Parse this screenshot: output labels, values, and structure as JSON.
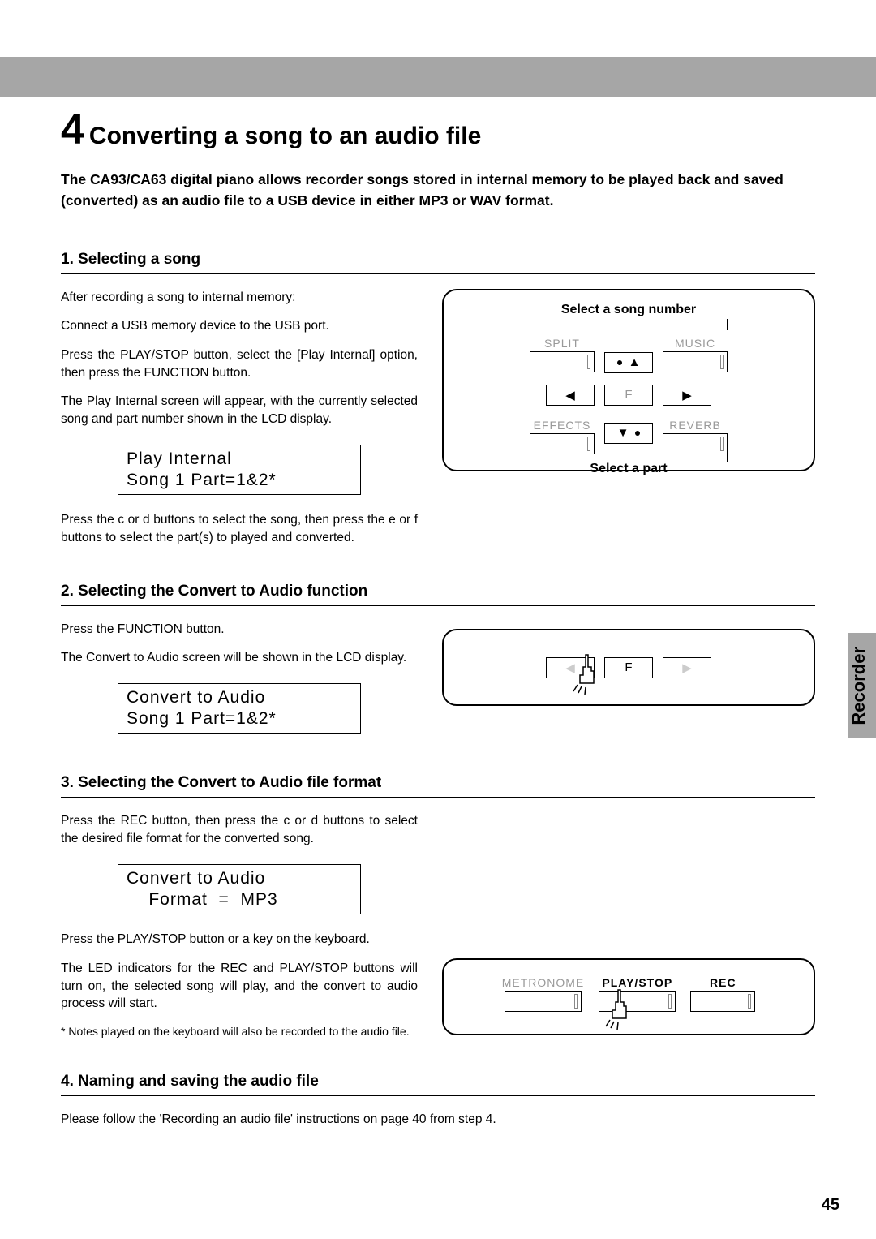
{
  "page_number": "45",
  "side_tab": "Recorder",
  "title_num": "4",
  "title_text": "Converting a song to an audio file",
  "intro": "The CA93/CA63 digital piano allows recorder songs stored in internal memory to be played back and saved (converted) as an audio file to a USB device in either MP3 or WAV format.",
  "s1": {
    "heading": "1.  Selecting a song",
    "p1": "After recording a song to internal memory:",
    "p2": "Connect a USB memory device to the USB port.",
    "p3": "Press the PLAY/STOP button, select the [Play Internal] option, then press the FUNCTION button.",
    "p4": "The Play Internal screen will appear, with the currently selected song and part number shown in the LCD display.",
    "lcd1_line1": "Play  Internal",
    "lcd1_line2": "Song  1  Part=1&2*",
    "p5": "Press the  c  or  d  buttons to select the song, then press the  e or  f  buttons to select the part(s) to played and converted.",
    "panel_top_label": "Select a song number",
    "panel_bottom_label": "Select a part",
    "label_split": "SPLIT",
    "label_music": "MUSIC",
    "label_effects": "EFFECTS",
    "label_reverb": "REVERB",
    "label_f": "F"
  },
  "s2": {
    "heading": "2.  Selecting the Convert to Audio function",
    "p1": "Press the FUNCTION button.",
    "p2": "The Convert to Audio screen will be shown in the LCD display.",
    "lcd_line1": "Convert  to  Audio",
    "lcd_line2": "Song  1  Part=1&2*",
    "label_f": "F"
  },
  "s3": {
    "heading": "3.  Selecting the Convert to Audio file format",
    "p1": "Press the REC button, then press the  c  or  d  buttons to select the desired file format for the converted song.",
    "lcd_line1": "Convert  to  Audio",
    "lcd_line2": "    Format  =  MP3",
    "p2": "Press the PLAY/STOP button or a key on the keyboard.",
    "p3": "The LED indicators for the REC and PLAY/STOP buttons will turn on, the selected song will play, and the convert to audio process will start.",
    "note": "* Notes played on the keyboard will also be recorded to the audio file.",
    "label_metronome": "METRONOME",
    "label_playstop": "PLAY/STOP",
    "label_rec": "REC"
  },
  "s4": {
    "heading": "4.  Naming and saving the audio file",
    "p1": "Please follow the 'Recording an audio file' instructions on page 40 from step 4."
  }
}
